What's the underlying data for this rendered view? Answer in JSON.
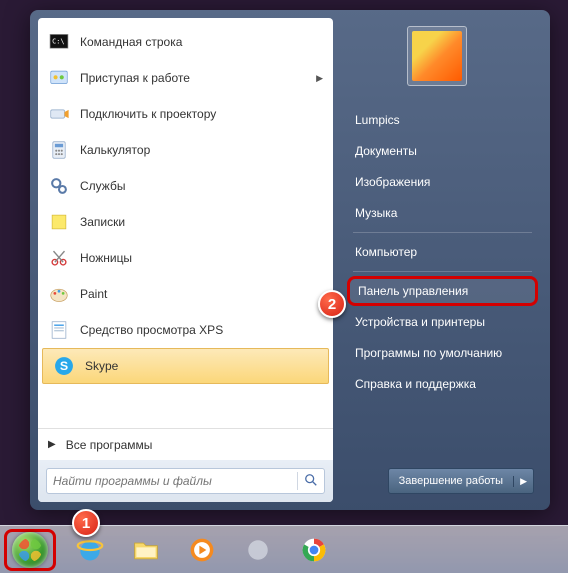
{
  "left": {
    "apps": [
      {
        "label": "Командная строка",
        "icon": "cmd",
        "sub": false
      },
      {
        "label": "Приступая к работе",
        "icon": "start",
        "sub": true
      },
      {
        "label": "Подключить к проектору",
        "icon": "projector",
        "sub": false
      },
      {
        "label": "Калькулятор",
        "icon": "calc",
        "sub": false
      },
      {
        "label": "Службы",
        "icon": "services",
        "sub": false
      },
      {
        "label": "Записки",
        "icon": "notes",
        "sub": false
      },
      {
        "label": "Ножницы",
        "icon": "snip",
        "sub": false
      },
      {
        "label": "Paint",
        "icon": "paint",
        "sub": false
      },
      {
        "label": "Средство просмотра XPS",
        "icon": "xps",
        "sub": false
      },
      {
        "label": "Skype",
        "icon": "skype",
        "sub": false
      }
    ],
    "all_programs": "Все программы",
    "search_placeholder": "Найти программы и файлы"
  },
  "right": {
    "items": [
      {
        "label": "Lumpics",
        "type": "item"
      },
      {
        "label": "Документы",
        "type": "item"
      },
      {
        "label": "Изображения",
        "type": "item"
      },
      {
        "label": "Музыка",
        "type": "item"
      },
      {
        "type": "sep"
      },
      {
        "label": "Компьютер",
        "type": "item"
      },
      {
        "type": "sep"
      },
      {
        "label": "Панель управления",
        "type": "item",
        "hl": true
      },
      {
        "label": "Устройства и принтеры",
        "type": "item"
      },
      {
        "label": "Программы по умолчанию",
        "type": "item"
      },
      {
        "label": "Справка и поддержка",
        "type": "item"
      }
    ],
    "shutdown": "Завершение работы"
  },
  "callouts": {
    "c1": "1",
    "c2": "2"
  }
}
